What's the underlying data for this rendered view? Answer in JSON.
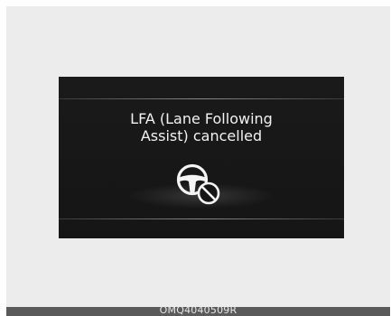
{
  "display": {
    "message_line1": "LFA (Lane Following",
    "message_line2": "Assist) cancelled",
    "icon": "steering-wheel-cancelled-icon"
  },
  "footer": {
    "code": "OMQ4040509R"
  },
  "colors": {
    "frame": "#ececec",
    "display": "#1a1a1a",
    "text": "#f2f2f2",
    "footer": "#5a5a5a"
  }
}
